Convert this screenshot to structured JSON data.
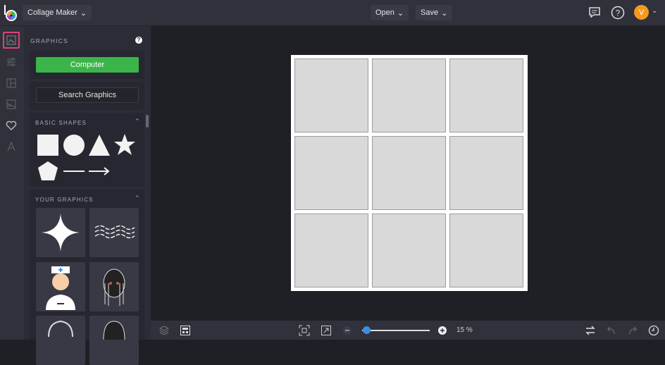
{
  "header": {
    "app_menu": "Collage Maker",
    "open": "Open",
    "save": "Save",
    "avatar_initial": "V"
  },
  "panel": {
    "title": "GRAPHICS",
    "computer_button": "Computer",
    "search_button": "Search Graphics",
    "basic_shapes": "BASIC SHAPES",
    "your_graphics": "YOUR GRAPHICS"
  },
  "footer": {
    "zoom": "15 %",
    "zoom_fraction": 0.03
  },
  "colors": {
    "accent_green": "#3bb54a",
    "active_rail": "#e0407a",
    "slider": "#3d8ee0",
    "avatar": "#f39a1e"
  }
}
